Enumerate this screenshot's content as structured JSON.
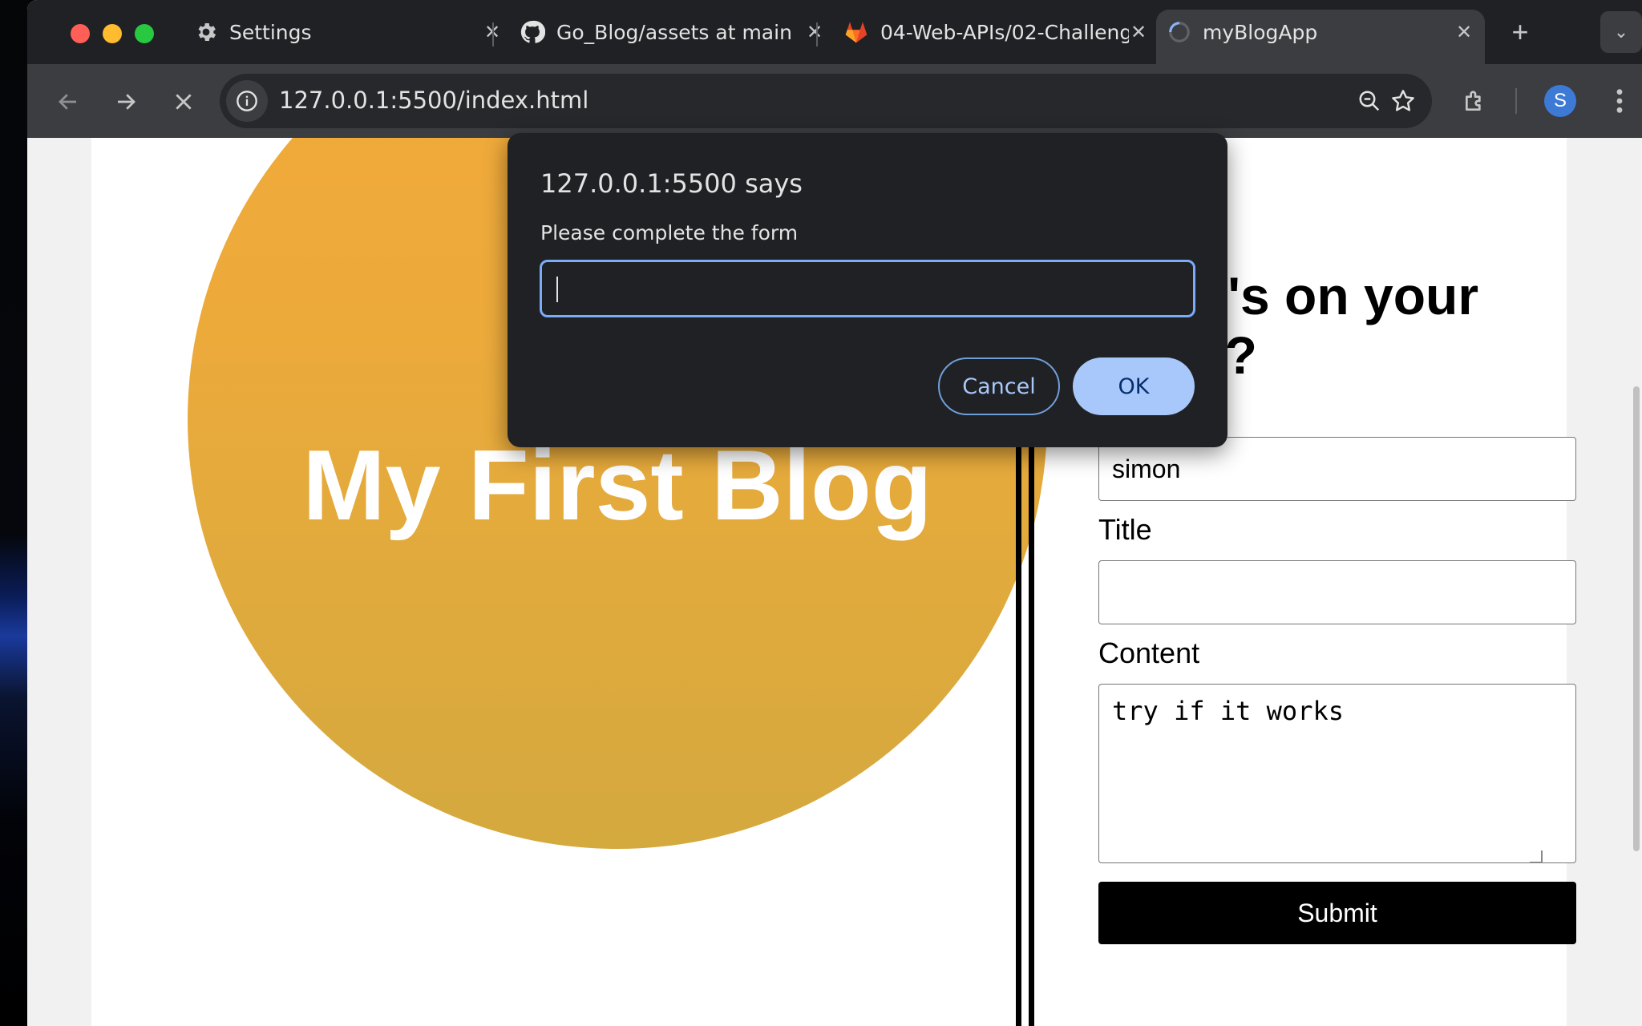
{
  "browser": {
    "tabs": [
      {
        "label": "Settings",
        "icon": "gear-icon"
      },
      {
        "label": "Go_Blog/assets at main",
        "icon": "github-icon"
      },
      {
        "label": "04-Web-APIs/02-Challenge",
        "icon": "gitlab-icon"
      },
      {
        "label": "myBlogApp",
        "icon": "loading-spinner-icon",
        "active": true
      }
    ],
    "url": "127.0.0.1:5500/index.html",
    "profile_initial": "S",
    "colors": {
      "close": "#ff5f57",
      "minimize": "#febc2e",
      "maximize": "#28c840"
    }
  },
  "page": {
    "blog_title": "My First Blog",
    "form_heading": "What's on your mind?",
    "username_value": "simon",
    "title_label": "Title",
    "title_value": "",
    "content_label": "Content",
    "content_value": "try if it works",
    "submit_label": "Submit"
  },
  "dialog": {
    "title": "127.0.0.1:5500 says",
    "message": "Please complete the form",
    "input_value": "",
    "cancel_label": "Cancel",
    "ok_label": "OK"
  }
}
